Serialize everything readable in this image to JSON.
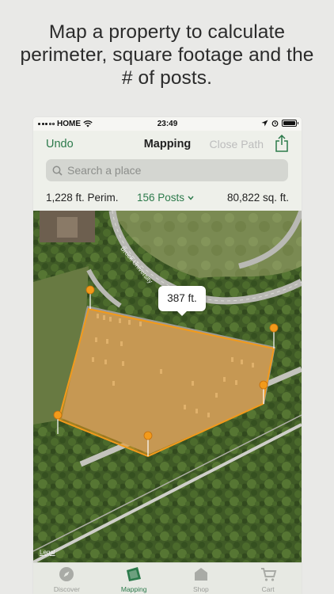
{
  "headline": {
    "line1": "Map a property to calculate",
    "line2": "perimeter, square footage and the",
    "line3": "# of posts."
  },
  "status_bar": {
    "carrier": "HOME",
    "time": "23:49"
  },
  "nav": {
    "undo_label": "Undo",
    "title": "Mapping",
    "close_path_label": "Close Path",
    "share_icon": "share-icon"
  },
  "search": {
    "placeholder": "Search a place"
  },
  "stats": {
    "perimeter": "1,228 ft. Perim.",
    "posts": "156 Posts",
    "area": "80,822 sq. ft."
  },
  "map": {
    "road_label": "Brock University",
    "segment_length": "387 ft.",
    "legal": "Legal",
    "polygon_color": "#e8951f"
  },
  "tabs": [
    {
      "label": "Discover",
      "icon": "compass-icon",
      "active": false
    },
    {
      "label": "Mapping",
      "icon": "mapping-icon",
      "active": true
    },
    {
      "label": "Shop",
      "icon": "shop-icon",
      "active": false
    },
    {
      "label": "Cart",
      "icon": "cart-icon",
      "active": false
    }
  ],
  "colors": {
    "accent": "#2c7a4b",
    "disabled": "#bdbdbd",
    "polygon": "#e8951f"
  }
}
